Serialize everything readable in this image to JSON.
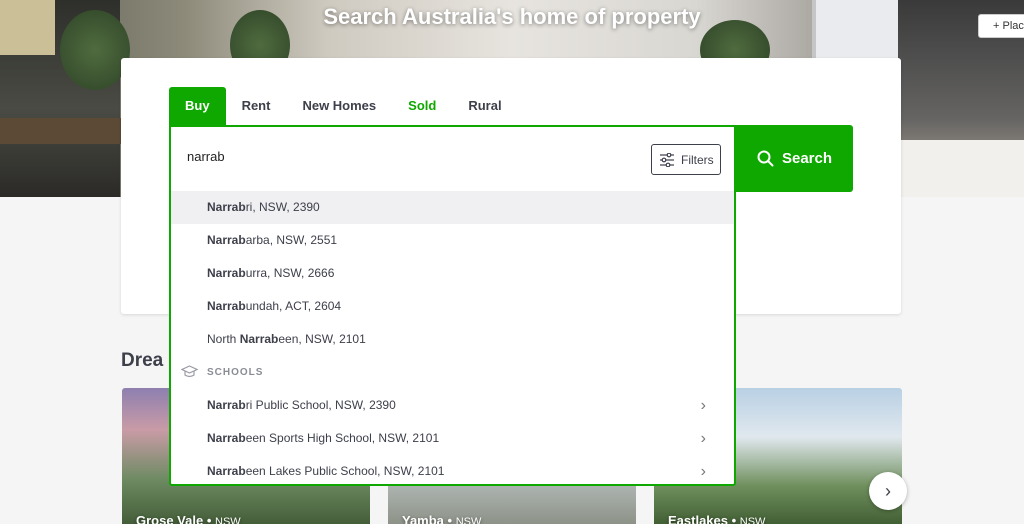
{
  "hero": {
    "title": "Search Australia's home of property",
    "place_button": "+ Place"
  },
  "tabs": [
    {
      "label": "Buy",
      "active": true
    },
    {
      "label": "Rent"
    },
    {
      "label": "New Homes"
    },
    {
      "label": "Sold"
    },
    {
      "label": "Rural"
    }
  ],
  "search": {
    "value": "narrab",
    "filters_label": "Filters",
    "button_label": "Search"
  },
  "suggestions": [
    {
      "bold": "Narrab",
      "rest": "ri, NSW, 2390"
    },
    {
      "bold": "Narrab",
      "rest": "arba, NSW, 2551"
    },
    {
      "bold": "Narrab",
      "rest": "urra, NSW, 2666"
    },
    {
      "bold": "Narrab",
      "rest": "undah, ACT, 2604"
    },
    {
      "prefix": "North ",
      "bold": "Narrab",
      "rest": "een, NSW, 2101"
    }
  ],
  "schools": {
    "heading": "SCHOOLS",
    "items": [
      {
        "bold": "Narrab",
        "rest": "ri Public School, NSW, 2390"
      },
      {
        "bold": "Narrab",
        "rest": "een Sports High School, NSW, 2101"
      },
      {
        "bold": "Narrab",
        "rest": "een Lakes Public School, NSW, 2101"
      }
    ]
  },
  "dream": {
    "heading": "Drea"
  },
  "tiles": [
    {
      "name": "Grose Vale",
      "state": "NSW"
    },
    {
      "name": "Yamba",
      "state": "NSW"
    },
    {
      "name": "Eastlakes",
      "state": "NSW"
    }
  ],
  "colors": {
    "brand_green": "#0ea800",
    "text": "#3d3f4a"
  }
}
